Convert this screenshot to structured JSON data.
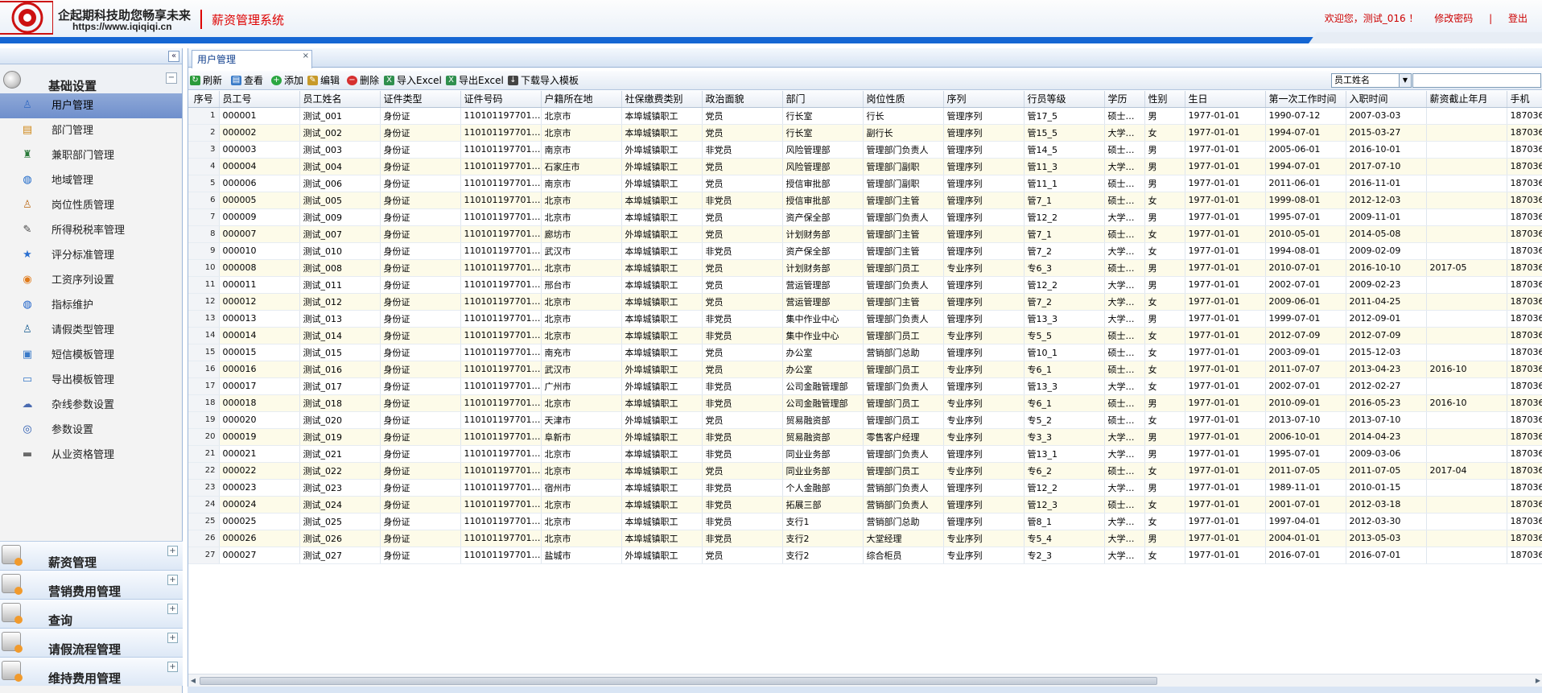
{
  "header": {
    "brand_line1": "企起期科技助您畅享未来",
    "brand_line2": "https://www.iqiqiqi.cn",
    "system_title": "薪资管理系统",
    "welcome": "欢迎您，测试_016 ！",
    "change_password": "修改密码",
    "separator": "|",
    "logout": "登出"
  },
  "sidebar": {
    "collapse": "«",
    "group1": {
      "label": "基础设置",
      "toggle": "−"
    },
    "items": [
      {
        "label": "用户管理",
        "icon": "user-icon",
        "glyph": "♙",
        "active": true
      },
      {
        "label": "部门管理",
        "icon": "department-icon",
        "glyph": "▤"
      },
      {
        "label": "兼职部门管理",
        "icon": "part-time-dept-icon",
        "glyph": "♜"
      },
      {
        "label": "地域管理",
        "icon": "globe-icon",
        "glyph": "◍"
      },
      {
        "label": "岗位性质管理",
        "icon": "position-icon",
        "glyph": "♙"
      },
      {
        "label": "所得税税率管理",
        "icon": "pen-icon",
        "glyph": "✎"
      },
      {
        "label": "评分标准管理",
        "icon": "star-icon",
        "glyph": "★"
      },
      {
        "label": "工资序列设置",
        "icon": "salary-icon",
        "glyph": "◉"
      },
      {
        "label": "指标维护",
        "icon": "indicator-icon",
        "glyph": "◍"
      },
      {
        "label": "请假类型管理",
        "icon": "leave-icon",
        "glyph": "♙"
      },
      {
        "label": "短信模板管理",
        "icon": "sms-icon",
        "glyph": "▣"
      },
      {
        "label": "导出模板管理",
        "icon": "export-icon",
        "glyph": "▭"
      },
      {
        "label": "杂线参数设置",
        "icon": "params-icon",
        "glyph": "☁"
      },
      {
        "label": "参数设置",
        "icon": "settings-icon",
        "glyph": "◎"
      },
      {
        "label": "从业资格管理",
        "icon": "qualification-icon",
        "glyph": "▬"
      }
    ],
    "groups": [
      {
        "label": "薪资管理",
        "toggle": "+"
      },
      {
        "label": "营销费用管理",
        "toggle": "+"
      },
      {
        "label": "查询",
        "toggle": "+"
      },
      {
        "label": "请假流程管理",
        "toggle": "+"
      },
      {
        "label": "维持费用管理",
        "toggle": "+"
      }
    ]
  },
  "tab": {
    "label": "用户管理",
    "close": "×"
  },
  "toolbar": {
    "refresh": "刷新",
    "view": "查看",
    "add": "添加",
    "edit": "编辑",
    "delete": "删除",
    "import_excel": "导入Excel",
    "export_excel": "导出Excel",
    "download_template": "下载导入模板",
    "search_field": "员工姓名",
    "search_value": ""
  },
  "colors": {
    "accent": "#1566d3",
    "alert": "#cc0000",
    "row_alt": "#fdfbe9"
  },
  "table": {
    "columns": [
      "序号",
      "员工号",
      "员工姓名",
      "证件类型",
      "证件号码",
      "户籍所在地",
      "社保缴费类别",
      "政治面貌",
      "部门",
      "岗位性质",
      "序列",
      "行员等级",
      "学历",
      "性别",
      "生日",
      "第一次工作时间",
      "入职时间",
      "薪资截止年月",
      "手机"
    ],
    "rows": [
      [
        "1",
        "000001",
        "测试_001",
        "身份证",
        "1101011977010…",
        "北京市",
        "本埠城镇职工",
        "党员",
        "行长室",
        "行长",
        "管理序列",
        "管17_5",
        "硕士…",
        "男",
        "1977-01-01",
        "1990-07-12",
        "2007-03-03",
        "",
        "187036"
      ],
      [
        "2",
        "000002",
        "测试_002",
        "身份证",
        "1101011977010…",
        "北京市",
        "本埠城镇职工",
        "党员",
        "行长室",
        "副行长",
        "管理序列",
        "管15_5",
        "大学…",
        "女",
        "1977-01-01",
        "1994-07-01",
        "2015-03-27",
        "",
        "187036"
      ],
      [
        "3",
        "000003",
        "测试_003",
        "身份证",
        "1101011977010…",
        "南京市",
        "外埠城镇职工",
        "非党员",
        "风险管理部",
        "管理部门负责人",
        "管理序列",
        "管14_5",
        "硕士…",
        "男",
        "1977-01-01",
        "2005-06-01",
        "2016-10-01",
        "",
        "187036"
      ],
      [
        "4",
        "000004",
        "测试_004",
        "身份证",
        "1101011977010…",
        "石家庄市",
        "外埠城镇职工",
        "党员",
        "风险管理部",
        "管理部门副职",
        "管理序列",
        "管11_3",
        "大学…",
        "男",
        "1977-01-01",
        "1994-07-01",
        "2017-07-10",
        "",
        "187036"
      ],
      [
        "5",
        "000006",
        "测试_006",
        "身份证",
        "1101011977010…",
        "南京市",
        "外埠城镇职工",
        "党员",
        "授信审批部",
        "管理部门副职",
        "管理序列",
        "管11_1",
        "硕士…",
        "男",
        "1977-01-01",
        "2011-06-01",
        "2016-11-01",
        "",
        "187036"
      ],
      [
        "6",
        "000005",
        "测试_005",
        "身份证",
        "1101011977010…",
        "北京市",
        "本埠城镇职工",
        "非党员",
        "授信审批部",
        "管理部门主管",
        "管理序列",
        "管7_1",
        "硕士…",
        "女",
        "1977-01-01",
        "1999-08-01",
        "2012-12-03",
        "",
        "187036"
      ],
      [
        "7",
        "000009",
        "测试_009",
        "身份证",
        "1101011977010…",
        "北京市",
        "本埠城镇职工",
        "党员",
        "资产保全部",
        "管理部门负责人",
        "管理序列",
        "管12_2",
        "大学…",
        "男",
        "1977-01-01",
        "1995-07-01",
        "2009-11-01",
        "",
        "187036"
      ],
      [
        "8",
        "000007",
        "测试_007",
        "身份证",
        "1101011977010…",
        "廊坊市",
        "外埠城镇职工",
        "党员",
        "计划财务部",
        "管理部门主管",
        "管理序列",
        "管7_1",
        "硕士…",
        "女",
        "1977-01-01",
        "2010-05-01",
        "2014-05-08",
        "",
        "187036"
      ],
      [
        "9",
        "000010",
        "测试_010",
        "身份证",
        "1101011977010…",
        "武汉市",
        "本埠城镇职工",
        "非党员",
        "资产保全部",
        "管理部门主管",
        "管理序列",
        "管7_2",
        "大学…",
        "女",
        "1977-01-01",
        "1994-08-01",
        "2009-02-09",
        "",
        "187036"
      ],
      [
        "10",
        "000008",
        "测试_008",
        "身份证",
        "1101011977010…",
        "北京市",
        "本埠城镇职工",
        "党员",
        "计划财务部",
        "管理部门员工",
        "专业序列",
        "专6_3",
        "硕士…",
        "男",
        "1977-01-01",
        "2010-07-01",
        "2016-10-10",
        "2017-05",
        "187036"
      ],
      [
        "11",
        "000011",
        "测试_011",
        "身份证",
        "1101011977010…",
        "邢台市",
        "本埠城镇职工",
        "党员",
        "营运管理部",
        "管理部门负责人",
        "管理序列",
        "管12_2",
        "大学…",
        "男",
        "1977-01-01",
        "2002-07-01",
        "2009-02-23",
        "",
        "187036"
      ],
      [
        "12",
        "000012",
        "测试_012",
        "身份证",
        "1101011977010…",
        "北京市",
        "本埠城镇职工",
        "党员",
        "营运管理部",
        "管理部门主管",
        "管理序列",
        "管7_2",
        "大学…",
        "女",
        "1977-01-01",
        "2009-06-01",
        "2011-04-25",
        "",
        "187036"
      ],
      [
        "13",
        "000013",
        "测试_013",
        "身份证",
        "1101011977010…",
        "北京市",
        "本埠城镇职工",
        "非党员",
        "集中作业中心",
        "管理部门负责人",
        "管理序列",
        "管13_3",
        "大学…",
        "男",
        "1977-01-01",
        "1999-07-01",
        "2012-09-01",
        "",
        "187036"
      ],
      [
        "14",
        "000014",
        "测试_014",
        "身份证",
        "1101011977010…",
        "北京市",
        "本埠城镇职工",
        "非党员",
        "集中作业中心",
        "管理部门员工",
        "专业序列",
        "专5_5",
        "硕士…",
        "女",
        "1977-01-01",
        "2012-07-09",
        "2012-07-09",
        "",
        "187036"
      ],
      [
        "15",
        "000015",
        "测试_015",
        "身份证",
        "1101011977010…",
        "南充市",
        "本埠城镇职工",
        "党员",
        "办公室",
        "营销部门总助",
        "管理序列",
        "管10_1",
        "硕士…",
        "女",
        "1977-01-01",
        "2003-09-01",
        "2015-12-03",
        "",
        "187036"
      ],
      [
        "16",
        "000016",
        "测试_016",
        "身份证",
        "1101011977010…",
        "武汉市",
        "外埠城镇职工",
        "党员",
        "办公室",
        "管理部门员工",
        "专业序列",
        "专6_1",
        "硕士…",
        "女",
        "1977-01-01",
        "2011-07-07",
        "2013-04-23",
        "2016-10",
        "187036"
      ],
      [
        "17",
        "000017",
        "测试_017",
        "身份证",
        "1101011977010…",
        "广州市",
        "外埠城镇职工",
        "非党员",
        "公司金融管理部",
        "管理部门负责人",
        "管理序列",
        "管13_3",
        "大学…",
        "女",
        "1977-01-01",
        "2002-07-01",
        "2012-02-27",
        "",
        "187036"
      ],
      [
        "18",
        "000018",
        "测试_018",
        "身份证",
        "1101011977010…",
        "北京市",
        "本埠城镇职工",
        "非党员",
        "公司金融管理部",
        "管理部门员工",
        "专业序列",
        "专6_1",
        "硕士…",
        "男",
        "1977-01-01",
        "2010-09-01",
        "2016-05-23",
        "2016-10",
        "187036"
      ],
      [
        "19",
        "000020",
        "测试_020",
        "身份证",
        "1101011977010…",
        "天津市",
        "外埠城镇职工",
        "党员",
        "贸易融资部",
        "管理部门员工",
        "专业序列",
        "专5_2",
        "硕士…",
        "女",
        "1977-01-01",
        "2013-07-10",
        "2013-07-10",
        "",
        "187036"
      ],
      [
        "20",
        "000019",
        "测试_019",
        "身份证",
        "1101011977010…",
        "阜新市",
        "外埠城镇职工",
        "非党员",
        "贸易融资部",
        "零售客户经理",
        "专业序列",
        "专3_3",
        "大学…",
        "男",
        "1977-01-01",
        "2006-10-01",
        "2014-04-23",
        "",
        "187036"
      ],
      [
        "21",
        "000021",
        "测试_021",
        "身份证",
        "1101011977010…",
        "北京市",
        "本埠城镇职工",
        "非党员",
        "同业业务部",
        "管理部门负责人",
        "管理序列",
        "管13_1",
        "大学…",
        "男",
        "1977-01-01",
        "1995-07-01",
        "2009-03-06",
        "",
        "187036"
      ],
      [
        "22",
        "000022",
        "测试_022",
        "身份证",
        "1101011977010…",
        "北京市",
        "本埠城镇职工",
        "党员",
        "同业业务部",
        "管理部门员工",
        "专业序列",
        "专6_2",
        "硕士…",
        "女",
        "1977-01-01",
        "2011-07-05",
        "2011-07-05",
        "2017-04",
        "187036"
      ],
      [
        "23",
        "000023",
        "测试_023",
        "身份证",
        "1101011977010…",
        "宿州市",
        "本埠城镇职工",
        "非党员",
        "个人金融部",
        "营销部门负责人",
        "管理序列",
        "管12_2",
        "大学…",
        "男",
        "1977-01-01",
        "1989-11-01",
        "2010-01-15",
        "",
        "187036"
      ],
      [
        "24",
        "000024",
        "测试_024",
        "身份证",
        "1101011977010…",
        "北京市",
        "本埠城镇职工",
        "非党员",
        "拓展三部",
        "营销部门负责人",
        "管理序列",
        "管12_3",
        "硕士…",
        "女",
        "1977-01-01",
        "2001-07-01",
        "2012-03-18",
        "",
        "187036"
      ],
      [
        "25",
        "000025",
        "测试_025",
        "身份证",
        "1101011977010…",
        "北京市",
        "本埠城镇职工",
        "非党员",
        "支行1",
        "营销部门总助",
        "管理序列",
        "管8_1",
        "大学…",
        "女",
        "1977-01-01",
        "1997-04-01",
        "2012-03-30",
        "",
        "187036"
      ],
      [
        "26",
        "000026",
        "测试_026",
        "身份证",
        "1101011977010…",
        "北京市",
        "本埠城镇职工",
        "非党员",
        "支行2",
        "大堂经理",
        "专业序列",
        "专5_4",
        "大学…",
        "男",
        "1977-01-01",
        "2004-01-01",
        "2013-05-03",
        "",
        "187036"
      ],
      [
        "27",
        "000027",
        "测试_027",
        "身份证",
        "1101011977010…",
        "盐城市",
        "外埠城镇职工",
        "党员",
        "支行2",
        "综合柜员",
        "专业序列",
        "专2_3",
        "大学…",
        "女",
        "1977-01-01",
        "2016-07-01",
        "2016-07-01",
        "",
        "187036"
      ]
    ]
  }
}
